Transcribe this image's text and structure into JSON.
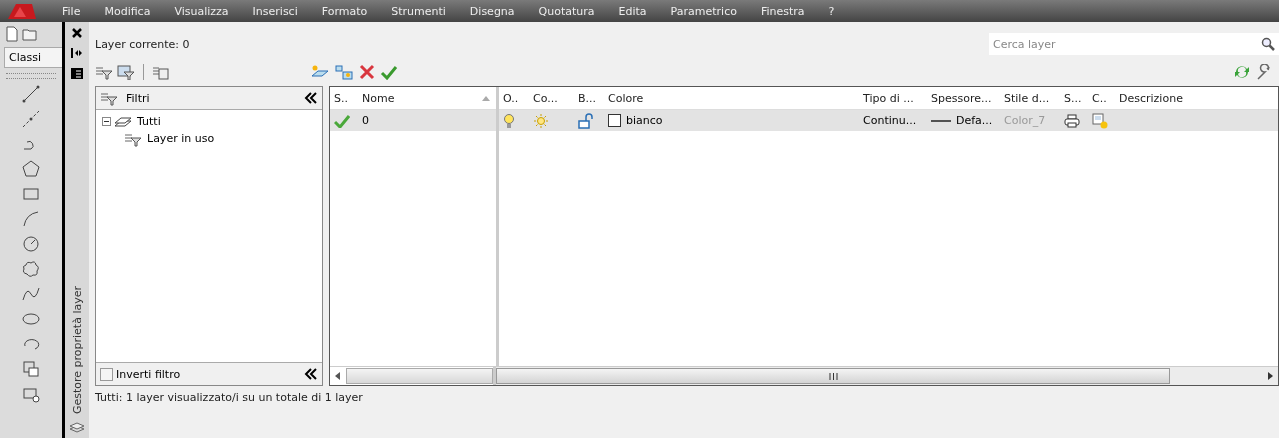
{
  "menu_bar": {
    "items": [
      "File",
      "Modifica",
      "Visualizza",
      "Inserisci",
      "Formato",
      "Strumenti",
      "Disegna",
      "Quotatura",
      "Edita",
      "Parametrico",
      "Finestra",
      "?"
    ]
  },
  "left_toolbar": {
    "workspace": "Classi"
  },
  "palette": {
    "title": "Gestore proprietà layer",
    "current_layer": "Layer corrente: 0",
    "search": {
      "placeholder": "Cerca layer"
    },
    "filter_tree": {
      "header": "Filtri",
      "items": [
        {
          "label": "Tutti",
          "expanded": true,
          "selected": false,
          "children": [
            {
              "label": "Layer in uso",
              "selected": false
            }
          ]
        }
      ],
      "invert_filter": {
        "label": "Inverti filtro",
        "checked": false
      }
    },
    "layer_table": {
      "columns": [
        "S..",
        "Nome",
        "O..",
        "Co...",
        "B...",
        "Colore",
        "Tipo di ...",
        "Spessore...",
        "Stile d...",
        "S...",
        "C..",
        "Descrizione"
      ],
      "rows": [
        {
          "selected": true,
          "current": true,
          "name": "0",
          "on": true,
          "frozen": false,
          "locked": false,
          "color_name": "bianco",
          "color": "#ffffff",
          "linetype": "Continu...",
          "lineweight": "Defa...",
          "plot_style": "Color_7",
          "plot_style_disabled": true,
          "plot": true,
          "vp_freeze": false
        }
      ]
    },
    "status_bar": "Tutti: 1 layer visualizzato/i su un totale di 1 layer"
  }
}
